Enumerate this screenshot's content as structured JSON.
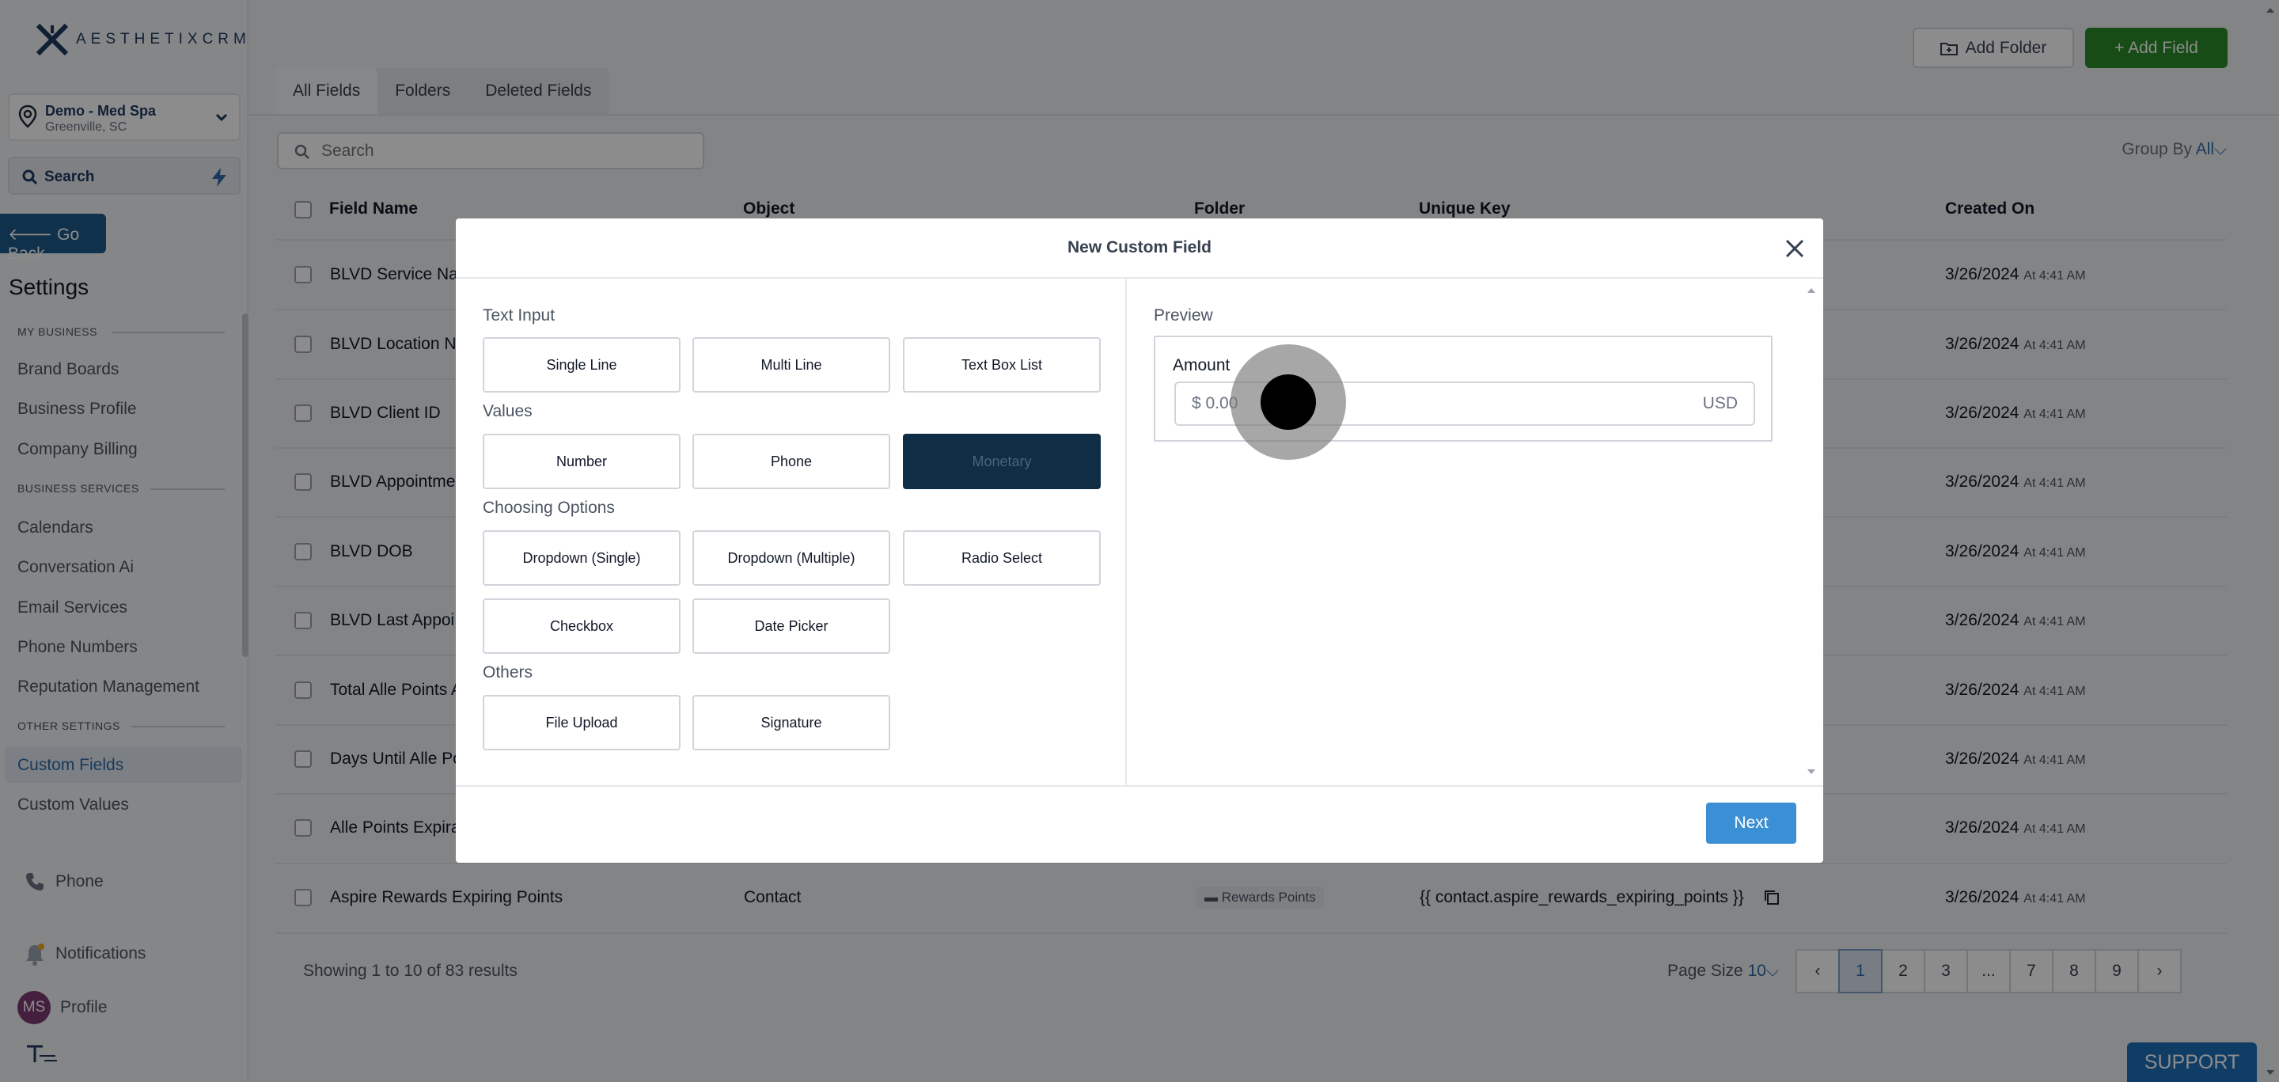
{
  "brand": {
    "mark": "X",
    "name": "AESTHETIXCRM",
    "accent": "#1e3a5f"
  },
  "location": {
    "name": "Demo - Med Spa",
    "city": "Greenville, SC"
  },
  "sidebar": {
    "search_label": "Search",
    "go_back": "Go Back",
    "settings_title": "Settings",
    "sections": [
      {
        "title": "MY BUSINESS",
        "items": [
          "Brand Boards",
          "Business Profile",
          "Company Billing"
        ]
      },
      {
        "title": "BUSINESS SERVICES",
        "items": [
          "Calendars",
          "Conversation Ai",
          "Email Services",
          "Phone Numbers",
          "Reputation Management"
        ]
      },
      {
        "title": "OTHER SETTINGS",
        "items": [
          "Custom Fields",
          "Custom Values"
        ]
      }
    ],
    "active_item": "Custom Fields",
    "bottom": {
      "phone": "Phone",
      "notifications": "Notifications",
      "profile": "Profile",
      "avatar_initials": "MS"
    }
  },
  "header": {
    "add_folder": "Add Folder",
    "add_field": "+ Add Field"
  },
  "tabs": [
    "All Fields",
    "Folders",
    "Deleted Fields"
  ],
  "search": {
    "placeholder": "Search"
  },
  "group_by": {
    "label": "Group By",
    "value": "All"
  },
  "table": {
    "columns": [
      "Field Name",
      "Object",
      "Folder",
      "Unique Key",
      "Created On"
    ],
    "rows": [
      {
        "name": "BLVD Service Na",
        "date": "3/26/2024",
        "time": "At 4:41 AM"
      },
      {
        "name": "BLVD Location N",
        "date": "3/26/2024",
        "time": "At 4:41 AM"
      },
      {
        "name": "BLVD Client ID",
        "date": "3/26/2024",
        "time": "At 4:41 AM"
      },
      {
        "name": "BLVD Appointme",
        "date": "3/26/2024",
        "time": "At 4:41 AM"
      },
      {
        "name": "BLVD DOB",
        "date": "3/26/2024",
        "time": "At 4:41 AM"
      },
      {
        "name": "BLVD Last Appoi",
        "date": "3/26/2024",
        "time": "At 4:41 AM"
      },
      {
        "name": "Total Alle Points A",
        "date": "3/26/2024",
        "time": "At 4:41 AM"
      },
      {
        "name": "Days Until Alle Po",
        "date": "3/26/2024",
        "time": "At 4:41 AM"
      },
      {
        "name": "Alle Points Expira",
        "date": "3/26/2024",
        "time": "At 4:41 AM"
      },
      {
        "name": "Aspire Rewards Expiring Points",
        "object": "Contact",
        "folder": "Rewards Points",
        "key": "{{ contact.aspire_rewards_expiring_points }}",
        "date": "3/26/2024",
        "time": "At 4:41 AM"
      }
    ]
  },
  "footer": {
    "showing": "Showing 1 to 10 of 83 results",
    "page_size_label": "Page Size",
    "page_size_value": "10",
    "pages": [
      "1",
      "2",
      "3",
      "...",
      "7",
      "8",
      "9"
    ],
    "current_page": "1"
  },
  "support": "SUPPORT",
  "modal": {
    "title": "New Custom Field",
    "groups": [
      {
        "label": "Text Input",
        "options": [
          "Single Line",
          "Multi Line",
          "Text Box List"
        ]
      },
      {
        "label": "Values",
        "options": [
          "Number",
          "Phone",
          "Monetary"
        ]
      },
      {
        "label": "Choosing Options",
        "options": [
          "Dropdown (Single)",
          "Dropdown (Multiple)",
          "Radio Select",
          "Checkbox",
          "Date Picker"
        ]
      },
      {
        "label": "Others",
        "options": [
          "File Upload",
          "Signature"
        ]
      }
    ],
    "selected_option": "Monetary",
    "preview": {
      "label": "Preview",
      "field_label": "Amount",
      "placeholder": "$ 0.00",
      "currency": "USD"
    },
    "next": "Next"
  }
}
